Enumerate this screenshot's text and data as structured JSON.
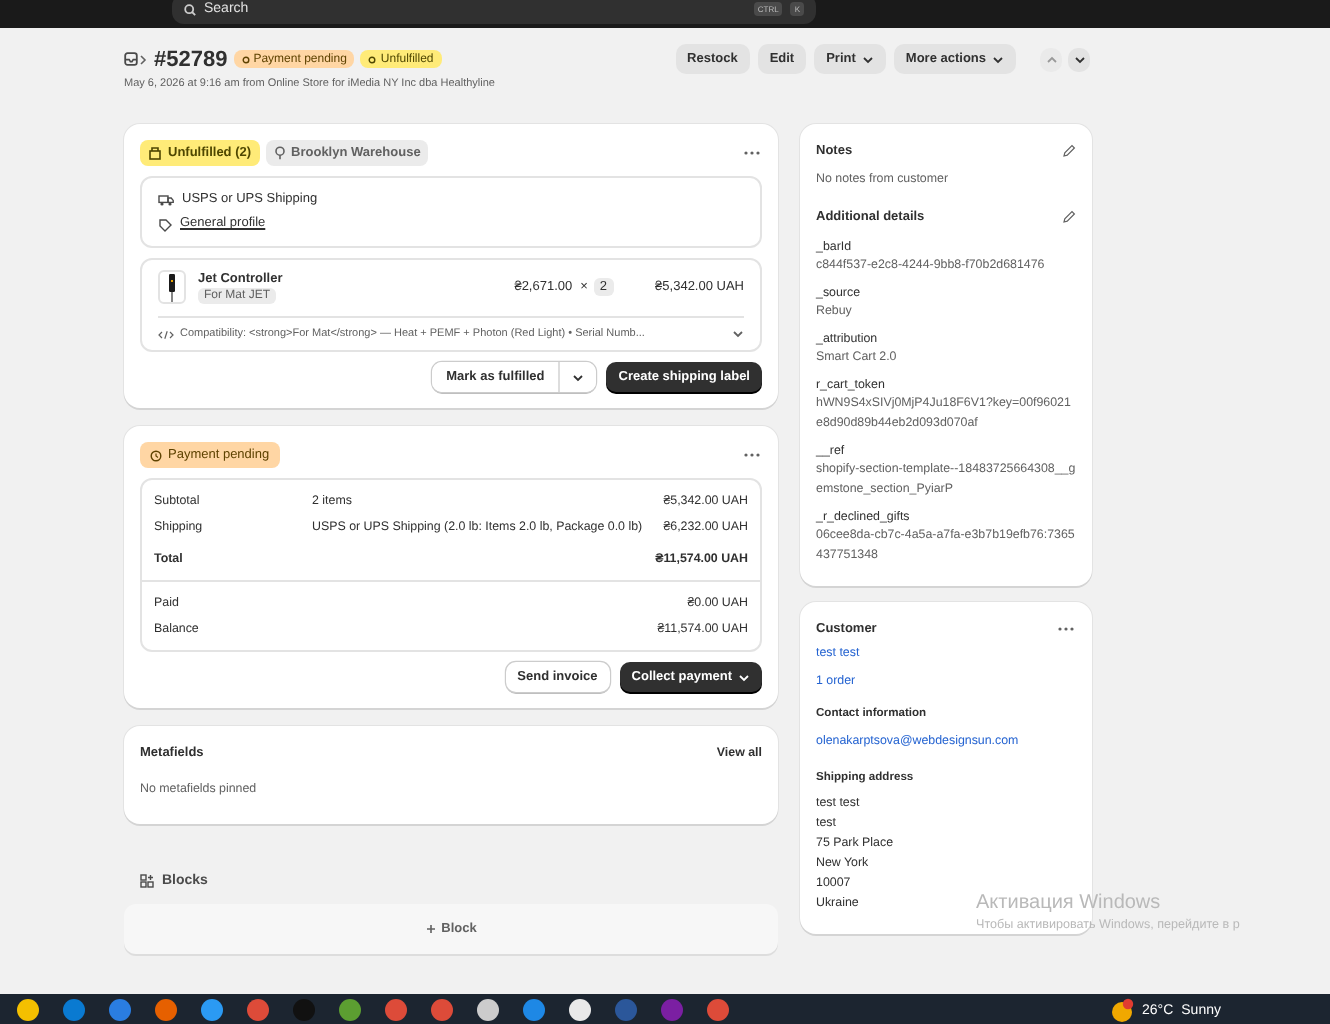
{
  "topbar": {
    "search_placeholder": "Search",
    "shortcut_keys": [
      "CTRL",
      "K"
    ]
  },
  "header": {
    "order_number": "#52789",
    "badges": [
      {
        "label": "Payment pending",
        "kind": "payment"
      },
      {
        "label": "Unfulfilled",
        "kind": "fulfillment"
      }
    ],
    "subtitle": "May 6, 2026 at 9:16 am from Online Store for iMedia NY Inc dba Healthyline",
    "actions": [
      {
        "label": "Restock",
        "dropdown": false
      },
      {
        "label": "Edit",
        "dropdown": false
      },
      {
        "label": "Print",
        "dropdown": true
      },
      {
        "label": "More actions",
        "dropdown": true
      }
    ],
    "nav": [
      {
        "kind": "previous",
        "disabled": true
      },
      {
        "kind": "next",
        "disabled": false
      }
    ]
  },
  "fulfillment": {
    "status": "Unfulfilled (2)",
    "location": "Brooklyn Warehouse",
    "shipping_method": "USPS or UPS Shipping",
    "profile_link": "General profile",
    "line_item": {
      "name": "Jet Controller",
      "variant": "For Mat JET",
      "price": "₴2,671.00",
      "times": "×",
      "quantity": "2",
      "total": "₴5,342.00 UAH",
      "property": "Compatibility: <strong>For Mat</strong> — Heat + PEMF + Photon (Red Light) • Serial Numb..."
    },
    "actions": [
      {
        "label": "Mark as fulfilled",
        "kind": "split"
      },
      {
        "label": "Create shipping label",
        "kind": "primary"
      }
    ]
  },
  "payment": {
    "status": "Payment pending",
    "sections": [
      {
        "rows": [
          {
            "label": "Subtotal",
            "detail": "2 items",
            "amount": "₴5,342.00 UAH",
            "kind": "normal"
          },
          {
            "label": "Shipping",
            "detail": "USPS or UPS Shipping (2.0 lb: Items 2.0 lb, Package 0.0 lb)",
            "amount": "₴6,232.00 UAH",
            "kind": "normal"
          },
          {
            "label": "Total",
            "amount": "₴11,574.00 UAH",
            "kind": "total"
          }
        ]
      },
      {
        "rows": [
          {
            "label": "Paid",
            "amount": "₴0.00 UAH",
            "kind": "normal"
          },
          {
            "label": "Balance",
            "amount": "₴11,574.00 UAH",
            "kind": "normal"
          }
        ]
      }
    ],
    "actions": [
      {
        "label": "Send invoice",
        "kind": "secondary"
      },
      {
        "label": "Collect payment",
        "kind": "primary-dropdown"
      }
    ]
  },
  "metafields": {
    "title": "Metafields",
    "link": "View all",
    "empty_text": "No metafields pinned"
  },
  "blocks": {
    "title": "Blocks",
    "add_label": "Block"
  },
  "notes": {
    "title": "Notes",
    "text": "No notes from customer",
    "details_title": "Additional details",
    "details": [
      {
        "key": "_barId",
        "value": "c844f537-e2c8-4244-9bb8-f70b2d681476"
      },
      {
        "key": "_source",
        "value": "Rebuy"
      },
      {
        "key": "_attribution",
        "value": "Smart Cart 2.0"
      },
      {
        "key": "r_cart_token",
        "value": "hWN9S4xSIVj0MjP4Ju18F6V1?key=00f96021e8d90d89b44eb2d093d070af"
      },
      {
        "key": "__ref",
        "value": "shopify-section-template--18483725664308__gemstone_section_PyiarP"
      },
      {
        "key": "_r_declined_gifts",
        "value": "06cee8da-cb7c-4a5a-a7fa-e3b7b19efb76:7365437751348"
      }
    ]
  },
  "customer": {
    "title": "Customer",
    "name": "test test",
    "orders": "1 order",
    "contact_title": "Contact information",
    "email": "olenakarptsova@webdesignsun.com",
    "shipping_title": "Shipping address",
    "address": [
      "test test",
      "test",
      "75 Park Place",
      "New York",
      "10007",
      "Ukraine"
    ]
  },
  "watermark": {
    "title": "Активация Windows",
    "text": "Чтобы активировать Windows, перейдите в р"
  },
  "taskbar": {
    "weather": {
      "temp": "26°C",
      "condition": "Sunny"
    }
  }
}
